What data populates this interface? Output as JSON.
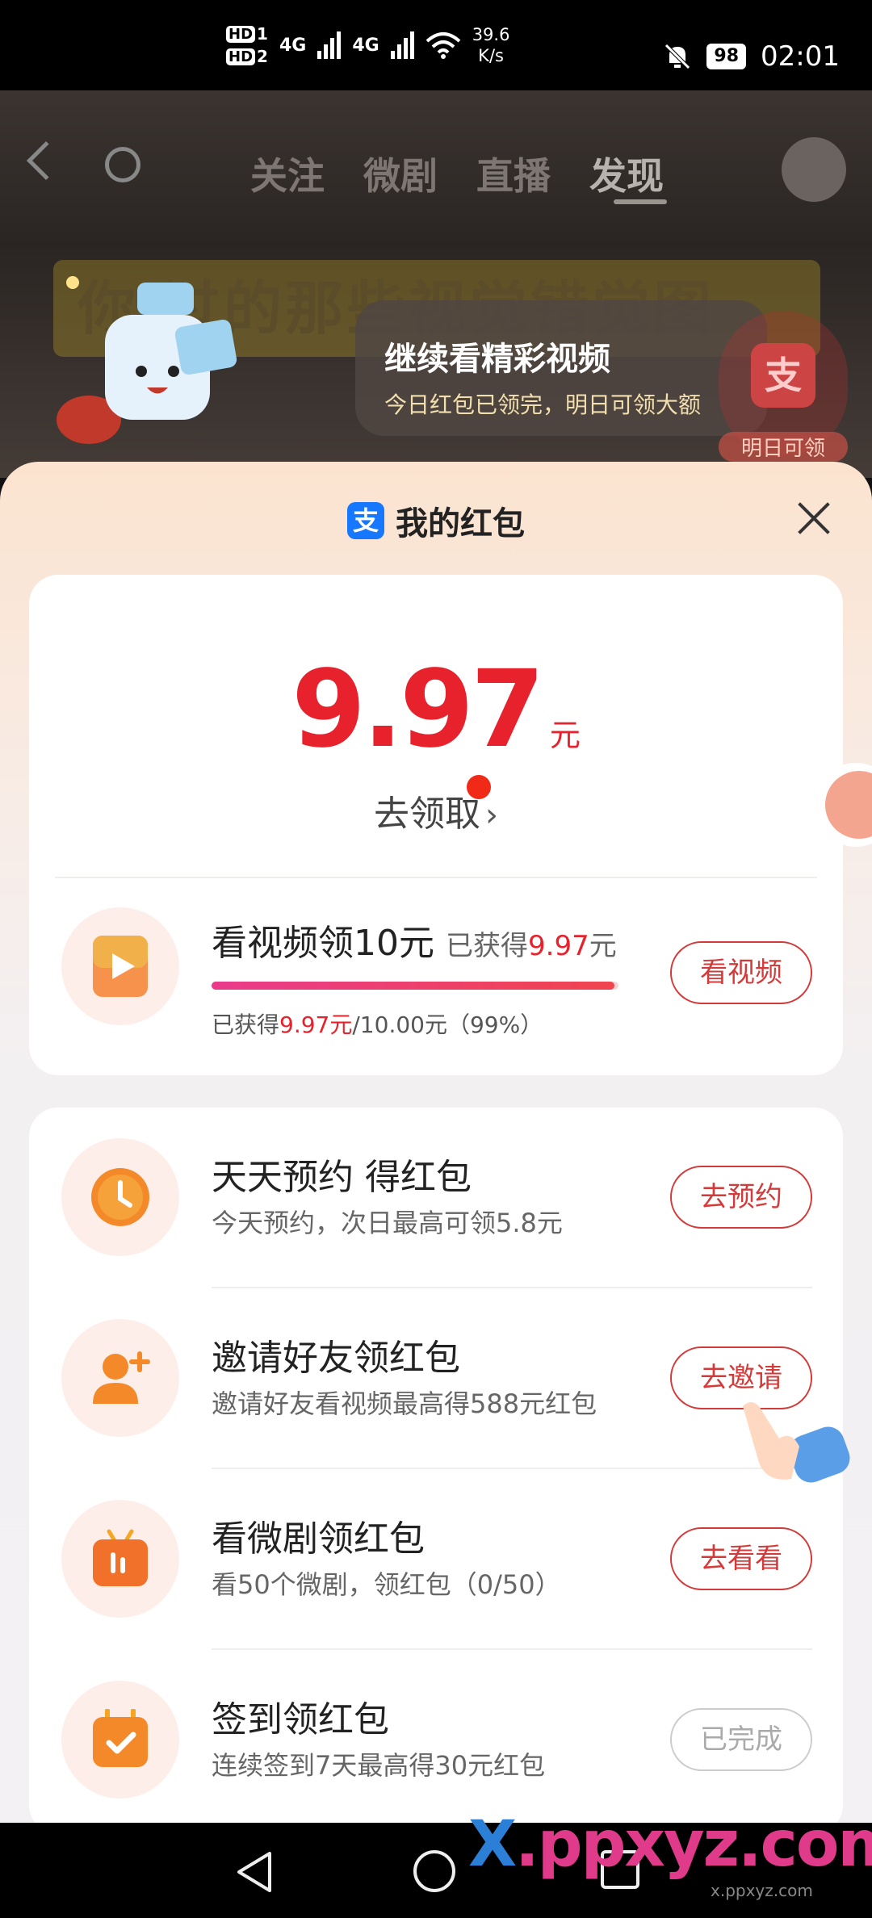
{
  "status_bar": {
    "hd1": "HD",
    "hd1_sim": "1",
    "hd2": "HD",
    "hd2_sim": "2",
    "net1": "4G",
    "net2": "4G",
    "speed_value": "39.6",
    "speed_unit": "K/s",
    "battery": "98",
    "time": "02:01"
  },
  "background_video": {
    "tabs": [
      "关注",
      "微剧",
      "直播",
      "发现"
    ],
    "active_tab": "发现",
    "caption": "你 过的那些视觉错觉图",
    "tip_title": "继续看精彩视频",
    "tip_subtitle": "今日红包已领完，明日可领大额",
    "side_badge_label": "明日可领",
    "side_badge_logo": "支"
  },
  "sheet": {
    "logo_char": "支",
    "title": "我的红包",
    "amount": "9.97",
    "amount_unit": "元",
    "claim_label": "去领取",
    "claim_arrow": "›"
  },
  "watch_task": {
    "title": "看视频领10元",
    "earned_prefix": "已获得",
    "earned_value": "9.97",
    "earned_suffix": "元",
    "progress_fraction": 0.99,
    "progress_prefix": "已获得",
    "progress_earned": "9.97元",
    "progress_rest": "/10.00元（99%）",
    "button": "看视频"
  },
  "tasks": [
    {
      "title": "天天预约 得红包",
      "subtitle": "今天预约，次日最高可领5.8元",
      "button": "去预约",
      "icon": "clock-icon",
      "done": false
    },
    {
      "title": "邀请好友领红包",
      "subtitle": "邀请好友看视频最高得588元红包",
      "button": "去邀请",
      "icon": "add-user-icon",
      "done": false
    },
    {
      "title": "看微剧领红包",
      "subtitle": "看50个微剧，领红包（0/50）",
      "button": "去看看",
      "icon": "tv-icon",
      "done": false
    },
    {
      "title": "签到领红包",
      "subtitle": "连续签到7天最高得30元红包",
      "button": "已完成",
      "icon": "calendar-check-icon",
      "done": true
    }
  ],
  "watermark": {
    "x": "X",
    "rest": ".ppxyz.com",
    "sub": "x.ppxyz.com"
  },
  "colors": {
    "accent_red": "#e8222c",
    "button_red": "#d33a3a",
    "alipay_blue": "#1677ff"
  }
}
